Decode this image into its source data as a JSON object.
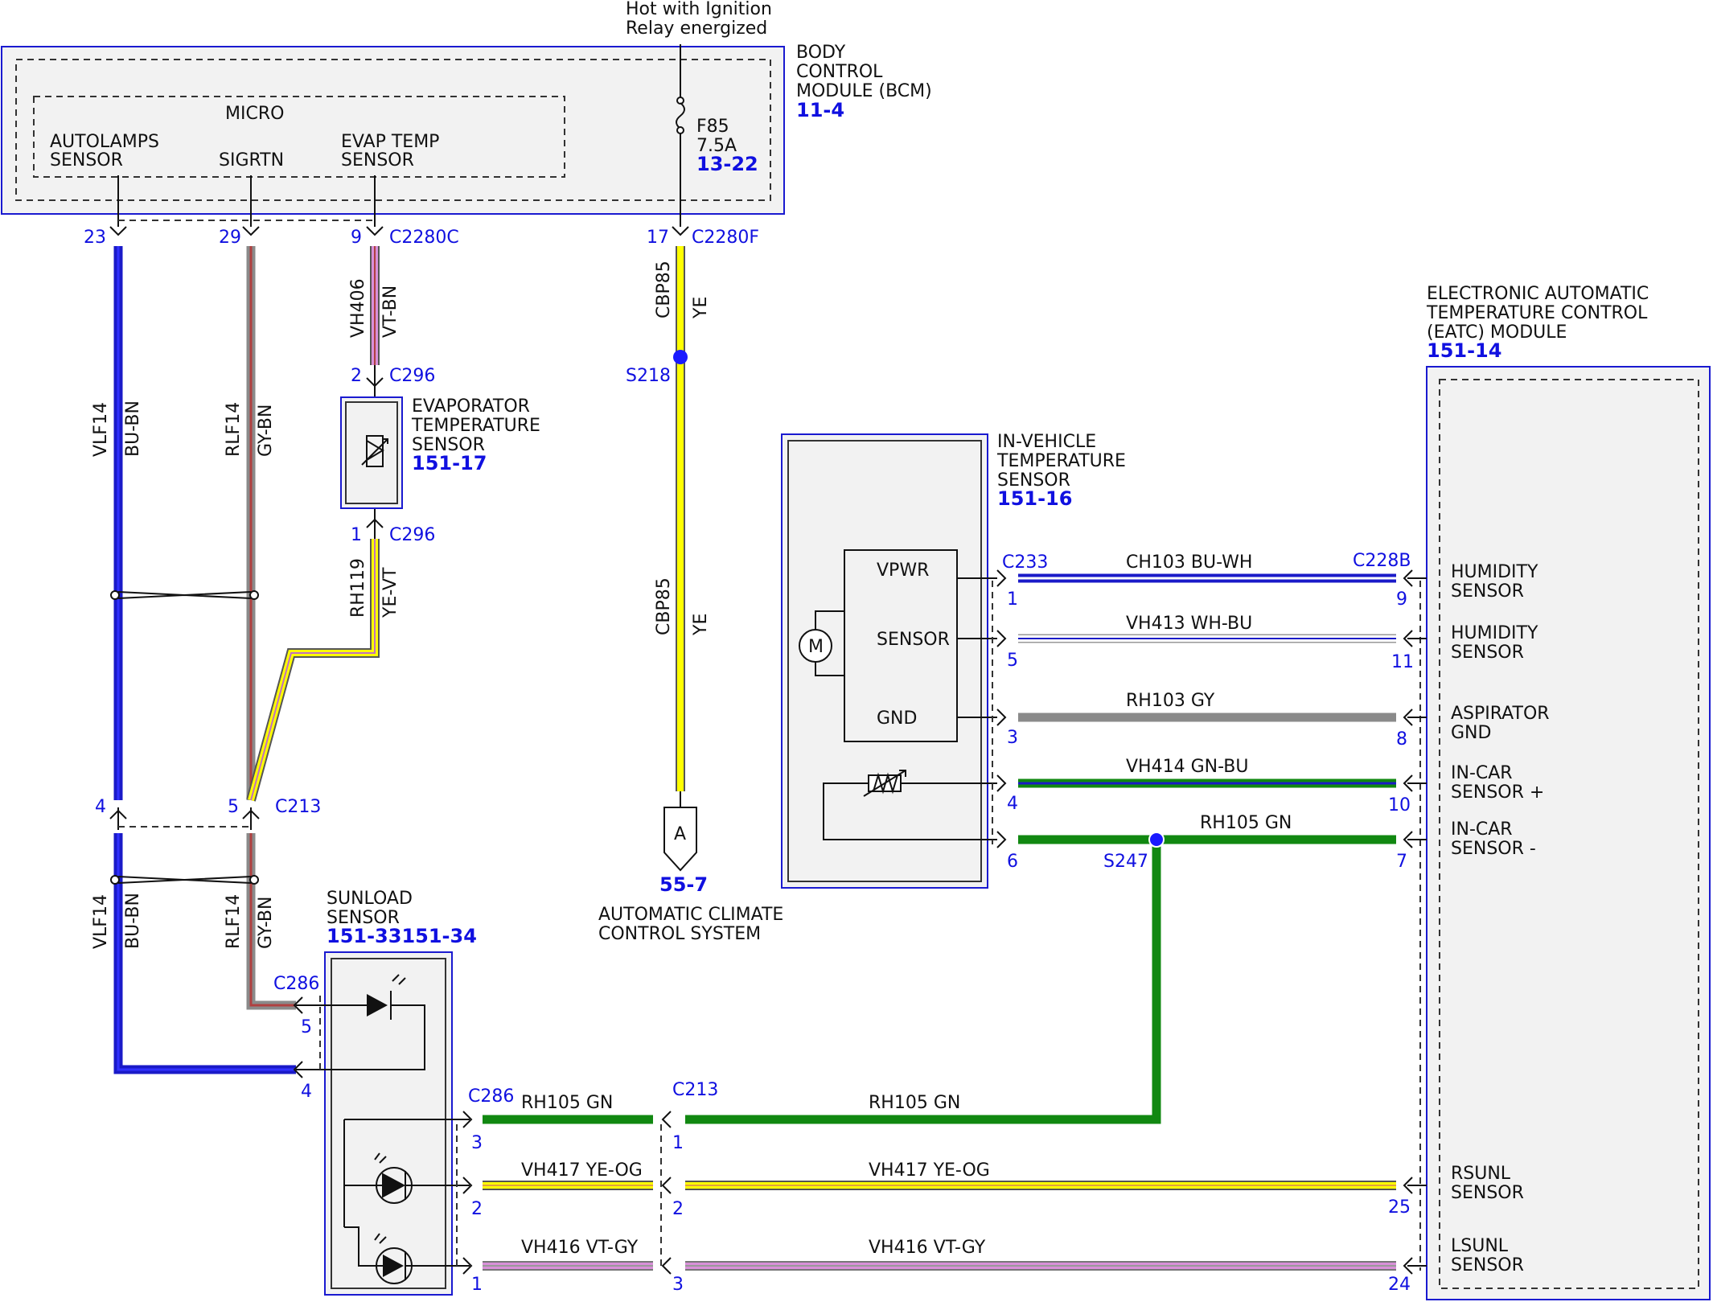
{
  "colors": {
    "blue_link": "#1010e0",
    "bu": "#1a1ac8",
    "gy": "#8a8a8a",
    "bn": "#b04040",
    "vt": "#d890d8",
    "ye": "#ffff00",
    "gn": "#118811",
    "wh": "#ffffff",
    "og": "#e0a040",
    "splice": "#1a1aff"
  },
  "power": {
    "line1": "Hot with Ignition",
    "line2": "Relay energized"
  },
  "bcm": {
    "title1": "BODY",
    "title2": "CONTROL",
    "title3": "MODULE (BCM)",
    "ref": "11-4",
    "micro": "MICRO",
    "autolamps1": "AUTOLAMPS",
    "autolamps2": "SENSOR",
    "sigrtn": "SIGRTN",
    "evap1": "EVAP TEMP",
    "evap2": "SENSOR",
    "fuse_name": "F85",
    "fuse_rating": "7.5A",
    "fuse_ref": "13-22"
  },
  "connectors": {
    "pin23": "23",
    "pin29": "29",
    "pin9": "9",
    "c2280c": "C2280C",
    "pin17": "17",
    "c2280f": "C2280F",
    "c296_pin2": "2",
    "c296_top": "C296",
    "c296_pin1": "1",
    "c296_bot": "C296",
    "c213_pin4": "4",
    "c213_pin5": "5",
    "c213_left": "C213",
    "c286_top": "C286",
    "c286_pin5": "5",
    "c286_pin4": "4",
    "c286_right": "C286",
    "c286_pin3": "3",
    "c286_pin2": "2",
    "c286_pin1": "1",
    "c213_right": "C213",
    "c213_pin1": "1",
    "c213_pin2": "2",
    "c213_pin3": "3",
    "c233": "C233",
    "c233_pin1": "1",
    "c233_pin5": "5",
    "c233_pin3": "3",
    "c233_pin4": "4",
    "c233_pin6": "6",
    "c228b": "C228B",
    "c228b_pin9": "9",
    "c228b_pin11": "11",
    "c228b_pin8": "8",
    "c228b_pin10": "10",
    "c228b_pin7": "7",
    "c228b_pin25": "25",
    "c228b_pin24": "24"
  },
  "wires": {
    "vlf14": "VLF14",
    "bu_bn": "BU-BN",
    "rlf14": "RLF14",
    "gy_bn": "GY-BN",
    "vh406": "VH406",
    "vt_bn": "VT-BN",
    "rh119": "RH119",
    "ye_vt": "YE-VT",
    "cbp85": "CBP85",
    "ye": "YE",
    "ch103": "CH103  BU-WH",
    "vh413": "VH413  WH-BU",
    "rh103": "RH103  GY",
    "vh414": "VH414  GN-BU",
    "rh105": "RH105  GN",
    "rh105_short": "RH105 GN",
    "rh105_long": "RH105  GN",
    "vh417_short": "VH417 YE-OG",
    "vh417_long": "VH417 YE-OG",
    "vh416_short": "VH416 VT-GY",
    "vh416_long": "VH416 VT-GY"
  },
  "splices": {
    "s218": "S218",
    "s247": "S247"
  },
  "evap_sensor": {
    "line1": "EVAPORATOR",
    "line2": "TEMPERATURE",
    "line3": "SENSOR",
    "ref": "151-17"
  },
  "acc": {
    "letter": "A",
    "ref": "55-7",
    "line1": "AUTOMATIC CLIMATE",
    "line2": "CONTROL SYSTEM"
  },
  "invehicle": {
    "line1": "IN-VEHICLE",
    "line2": "TEMPERATURE",
    "line3": "SENSOR",
    "ref": "151-16",
    "vpwr": "VPWR",
    "sensor": "SENSOR",
    "gnd": "GND",
    "motor": "M"
  },
  "sunload": {
    "line1": "SUNLOAD",
    "line2": "SENSOR",
    "ref": "151-33151-34"
  },
  "eatc": {
    "line1": "ELECTRONIC AUTOMATIC",
    "line2": "TEMPERATURE CONTROL",
    "line3": "(EATC) MODULE",
    "ref": "151-14",
    "humidity1a": "HUMIDITY",
    "humidity1b": "SENSOR",
    "humidity2a": "HUMIDITY",
    "humidity2b": "SENSOR",
    "aspa": "ASPIRATOR",
    "aspb": "GND",
    "incarpa": "IN-CAR",
    "incarpb": "SENSOR +",
    "incarma": "IN-CAR",
    "incarmb": "SENSOR -",
    "rsunla": "RSUNL",
    "rsunlb": "SENSOR",
    "lsunla": "LSUNL",
    "lsunlb": "SENSOR"
  }
}
